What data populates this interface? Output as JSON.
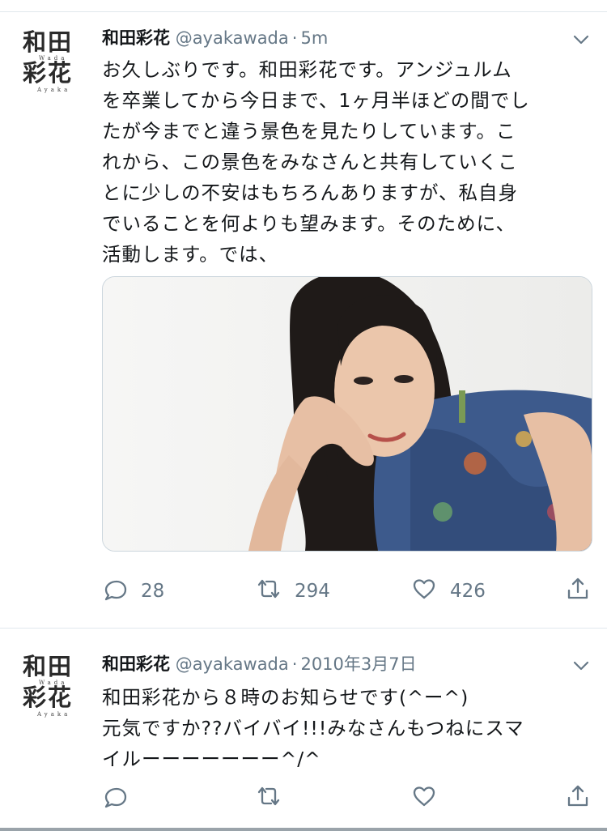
{
  "tweets": [
    {
      "avatar": {
        "big_top": "和田",
        "big_bottom": "彩花",
        "small_top": "Wada",
        "small_bottom": "Ayaka"
      },
      "name": "和田彩花",
      "handle": "@ayakawada",
      "dot": "·",
      "time": "5m",
      "lines": [
        "お久しぶりです。和田彩花です。アンジュルム",
        "を卒業してから今日まで、1ヶ月半ほどの間でし",
        "たが今までと違う景色を見たりしています。こ",
        "れから、この景色をみなさんと共有していくこ",
        "とに少しの不安はもちろんありますが、私自身",
        "でいることを何よりも望みます。そのために、",
        "活動します。では、"
      ],
      "actions": {
        "reply": "28",
        "retweet": "294",
        "like": "426",
        "share": ""
      },
      "icons": {
        "reply": "reply-icon",
        "retweet": "retweet-icon",
        "like": "heart-icon",
        "share": "share-icon",
        "menu": "chevron-down-icon"
      }
    },
    {
      "avatar": {
        "big_top": "和田",
        "big_bottom": "彩花",
        "small_top": "Wada",
        "small_bottom": "Ayaka"
      },
      "name": "和田彩花",
      "handle": "@ayakawada",
      "dot": "·",
      "time": "2010年3月7日",
      "lines": [
        "和田彩花から８時のお知らせです(^ー^)",
        "元気ですか??バイバイ!!!みなさんもつねにスマ",
        "イルーーーーーーー^/^"
      ],
      "actions": {
        "reply": "",
        "retweet": "",
        "like": "",
        "share": ""
      }
    }
  ],
  "colors": {
    "text": "#14171a",
    "secondary": "#657786",
    "border": "#e1e8ed"
  }
}
